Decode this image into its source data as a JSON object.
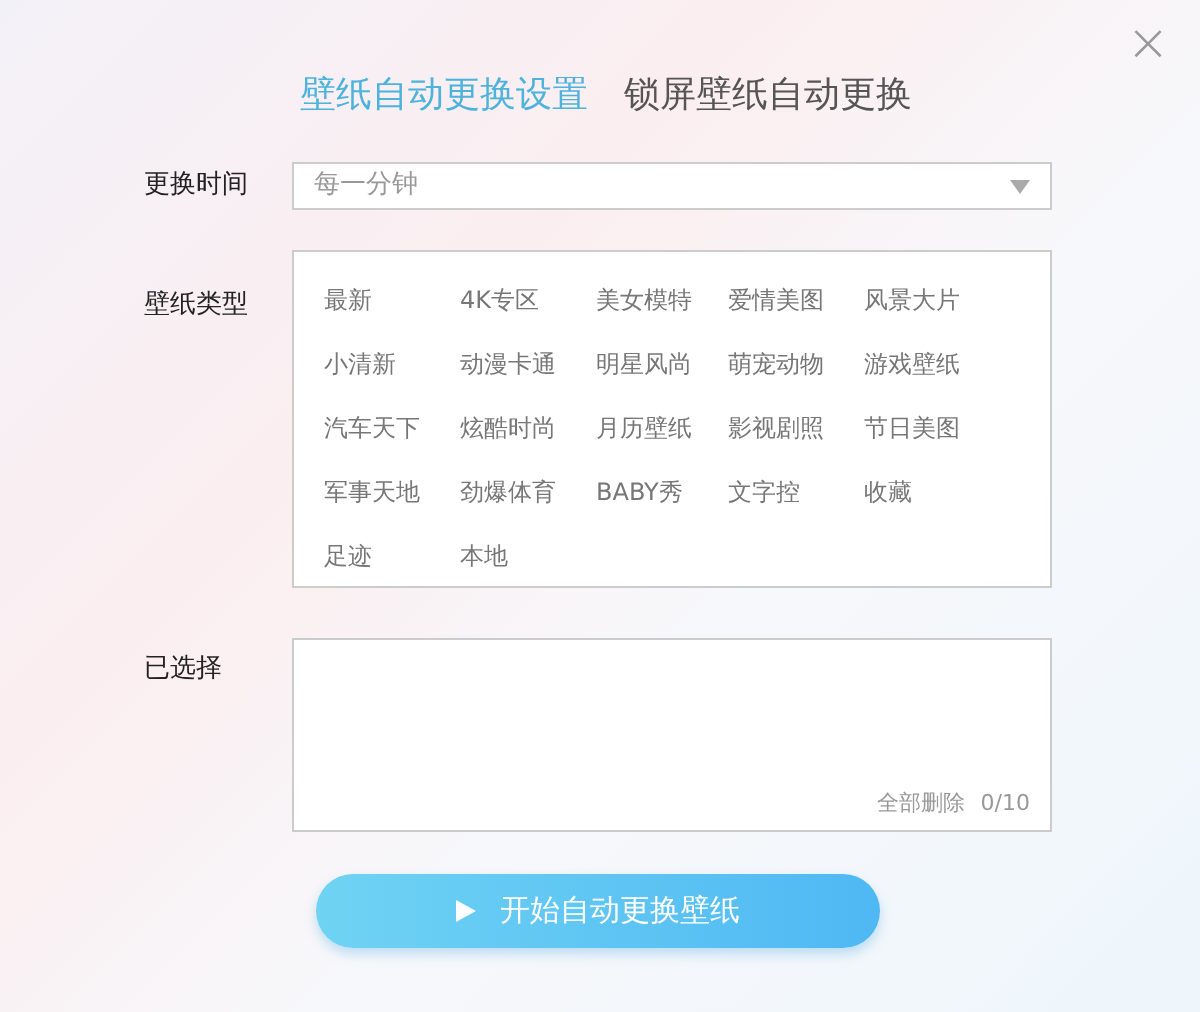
{
  "close_button": "×",
  "tabs": [
    {
      "label": "壁纸自动更换设置",
      "selected": true
    },
    {
      "label": "锁屏壁纸自动更换",
      "selected": false
    }
  ],
  "interval": {
    "label": "更换时间",
    "value": "每一分钟"
  },
  "types": {
    "label": "壁纸类型",
    "items": [
      "最新",
      "4K专区",
      "美女模特",
      "爱情美图",
      "风景大片",
      "小清新",
      "动漫卡通",
      "明星风尚",
      "萌宠动物",
      "游戏壁纸",
      "汽车天下",
      "炫酷时尚",
      "月历壁纸",
      "影视剧照",
      "节日美图",
      "军事天地",
      "劲爆体育",
      "BABY秀",
      "文字控",
      "收藏",
      "足迹",
      "本地"
    ]
  },
  "selected_area": {
    "label": "已选择",
    "clear_all": "全部删除",
    "count": "0/10"
  },
  "start_button": {
    "label": "开始自动更换壁纸"
  }
}
